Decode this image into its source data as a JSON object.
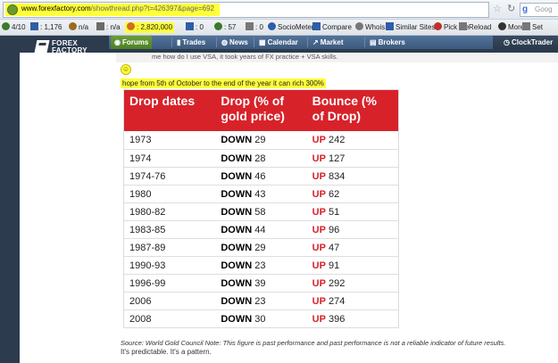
{
  "browser": {
    "url_domain": "www.forexfactory.com",
    "url_path": "/showthread.php?t=426397&page=692",
    "search_placeholder": "Goog"
  },
  "toolbar": {
    "items": [
      {
        "label": "4/10",
        "color": "#3a7a2a"
      },
      {
        "label": ": 1,176",
        "color": "#2f5ea8"
      },
      {
        "label": "n/a",
        "color": "#9a6a20"
      },
      {
        "label": ": n/a",
        "color": "#6a6a6a"
      },
      {
        "label": ": 2,820,000",
        "color": "#d07020"
      },
      {
        "label": ": 0",
        "color": "#2f5ea8"
      },
      {
        "label": ": 57",
        "color": "#3a7a2a"
      },
      {
        "label": ": 0",
        "color": "#777777"
      },
      {
        "label": "SocioMeter▾",
        "color": "#2f5ea8"
      },
      {
        "label": "Compare",
        "color": "#2f5ea8"
      },
      {
        "label": "Whois",
        "color": "#777777"
      },
      {
        "label": "Similar Sites",
        "color": "#2f5ea8"
      },
      {
        "label": "Pick Me",
        "color": "#c0302a"
      },
      {
        "label": "Reload",
        "color": "#777777"
      },
      {
        "label": "More",
        "color": "#333333"
      },
      {
        "label": "Set",
        "color": "#777777"
      }
    ]
  },
  "logo": {
    "line1": "FOREX",
    "line2": "FACTORY"
  },
  "nav": {
    "items": [
      {
        "label": "Forums",
        "icon": "◉"
      },
      {
        "label": "Trades",
        "icon": "▮"
      },
      {
        "label": "News",
        "icon": "◍"
      },
      {
        "label": "Calendar",
        "icon": "▦"
      },
      {
        "label": "Market",
        "icon": "↗"
      },
      {
        "label": "Brokers",
        "icon": "▤"
      }
    ],
    "right_label": "ClockTrader"
  },
  "post": {
    "quote_text": "me how do I use VSA, it took years of FX practice + VSA skills.",
    "body": "hope from 5th of October to the end of the year it can rich 300%",
    "source_note": "Source: World Gold Council Note: This figure is past performance and past performance is not a reliable indicator of future results.",
    "footnote": "It's predictable. It's a pattern."
  },
  "table": {
    "headers": [
      "Drop dates",
      "Drop (% of gold price)",
      "Bounce (% of Drop)"
    ],
    "header_lines": [
      [
        "Drop dates"
      ],
      [
        "Drop (% of",
        "gold price)"
      ],
      [
        "Bounce (%",
        "of Drop)"
      ]
    ],
    "down_label": "DOWN",
    "up_label": "UP",
    "rows": [
      {
        "date": "1973",
        "drop": "29",
        "bounce": "242"
      },
      {
        "date": "1974",
        "drop": "28",
        "bounce": "127"
      },
      {
        "date": "1974-76",
        "drop": "46",
        "bounce": "834"
      },
      {
        "date": "1980",
        "drop": "43",
        "bounce": "62"
      },
      {
        "date": "1980-82",
        "drop": "58",
        "bounce": "51"
      },
      {
        "date": "1983-85",
        "drop": "44",
        "bounce": "96"
      },
      {
        "date": "1987-89",
        "drop": "29",
        "bounce": "47"
      },
      {
        "date": "1990-93",
        "drop": "23",
        "bounce": "91"
      },
      {
        "date": "1996-99",
        "drop": "39",
        "bounce": "292"
      },
      {
        "date": "2006",
        "drop": "23",
        "bounce": "274"
      },
      {
        "date": "2008",
        "drop": "30",
        "bounce": "396"
      }
    ]
  }
}
